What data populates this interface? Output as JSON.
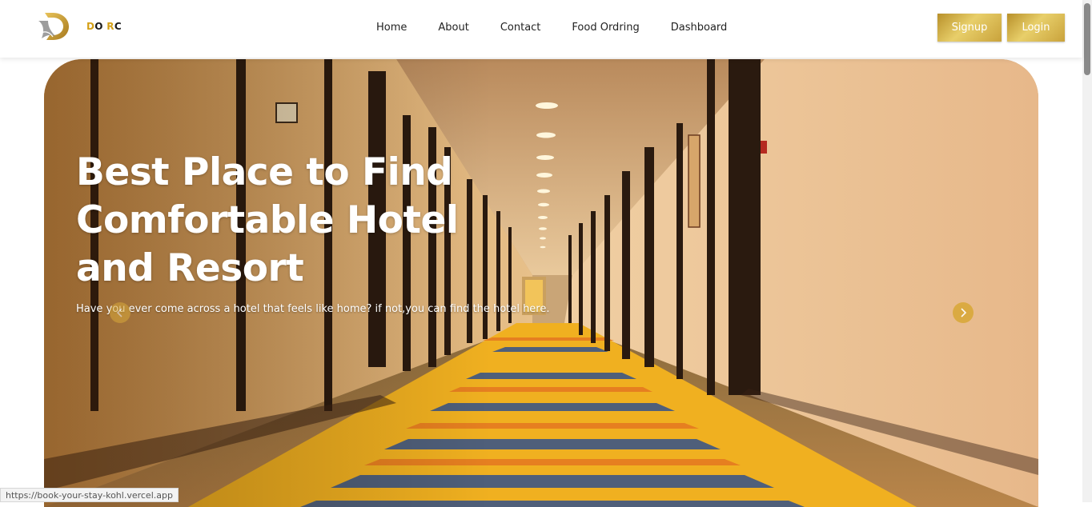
{
  "brand": {
    "letter1": "D",
    "letter2": "O",
    "letter3": "R",
    "letter4": "C",
    "logo_icon": "d-logo-icon"
  },
  "nav": {
    "links": [
      {
        "label": "Home"
      },
      {
        "label": "About"
      },
      {
        "label": "Contact"
      },
      {
        "label": "Food Ordring"
      },
      {
        "label": "Dashboard"
      }
    ],
    "signup_label": "Signup",
    "login_label": "Login"
  },
  "hero": {
    "title_line1": "Best Place to Find",
    "title_line2": "Comfortable Hotel",
    "title_line3": "and Resort",
    "subtitle": "Have you ever come across a hotel that feels like home? if not,you can find the hotel here.",
    "prev_icon": "chevron-left-icon",
    "next_icon": "chevron-right-icon"
  },
  "status_bar": {
    "url": "https://book-your-stay-kohl.vercel.app"
  },
  "colors": {
    "accent_gold": "#d4a017",
    "button_gold": "#c9a23b",
    "text_dark": "#222222"
  }
}
